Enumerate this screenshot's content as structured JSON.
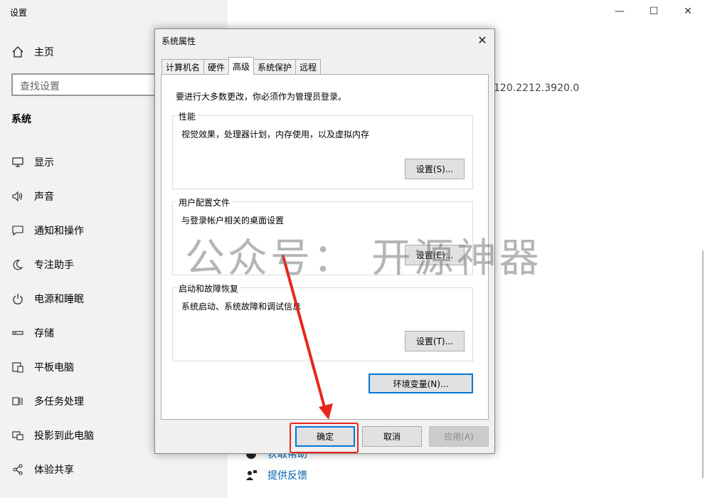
{
  "app": {
    "title": "设置"
  },
  "titlebar": {
    "minimize": "—",
    "maximize": "☐",
    "close": "✕"
  },
  "sidebar": {
    "home_label": "主页",
    "search_placeholder": "查找设置",
    "section_title": "系统",
    "items": [
      {
        "label": "显示",
        "icon": "monitor-icon"
      },
      {
        "label": "声音",
        "icon": "speaker-icon"
      },
      {
        "label": "通知和操作",
        "icon": "notification-icon"
      },
      {
        "label": "专注助手",
        "icon": "moon-icon"
      },
      {
        "label": "电源和睡眠",
        "icon": "power-icon"
      },
      {
        "label": "存储",
        "icon": "storage-icon"
      },
      {
        "label": "平板电脑",
        "icon": "tablet-icon"
      },
      {
        "label": "多任务处理",
        "icon": "multitask-icon"
      },
      {
        "label": "投影到此电脑",
        "icon": "project-icon"
      },
      {
        "label": "体验共享",
        "icon": "share-icon"
      }
    ]
  },
  "main": {
    "version_fragment": "120.2212.3920.0",
    "link_help": "获取帮助",
    "link_feedback": "提供反馈"
  },
  "dialog": {
    "title": "系统属性",
    "close": "✕",
    "tabs": [
      "计算机名",
      "硬件",
      "高级",
      "系统保护",
      "远程"
    ],
    "active_tab": "高级",
    "admin_note": "要进行大多数更改，你必须作为管理员登录。",
    "performance": {
      "title": "性能",
      "desc": "视觉效果，处理器计划，内存使用，以及虚拟内存",
      "button": "设置(S)..."
    },
    "profile": {
      "title": "用户配置文件",
      "desc": "与登录帐户相关的桌面设置",
      "button": "设置(E)..."
    },
    "startup": {
      "title": "启动和故障恢复",
      "desc": "系统启动、系统故障和调试信息",
      "button": "设置(T)..."
    },
    "env_button": "环境变量(N)...",
    "ok": "确定",
    "cancel": "取消",
    "apply": "应用(A)"
  },
  "watermark": "公众号： 开源神器",
  "colors": {
    "annotation": "#e8261c",
    "focus": "#0078d7",
    "link": "#0063b1"
  }
}
